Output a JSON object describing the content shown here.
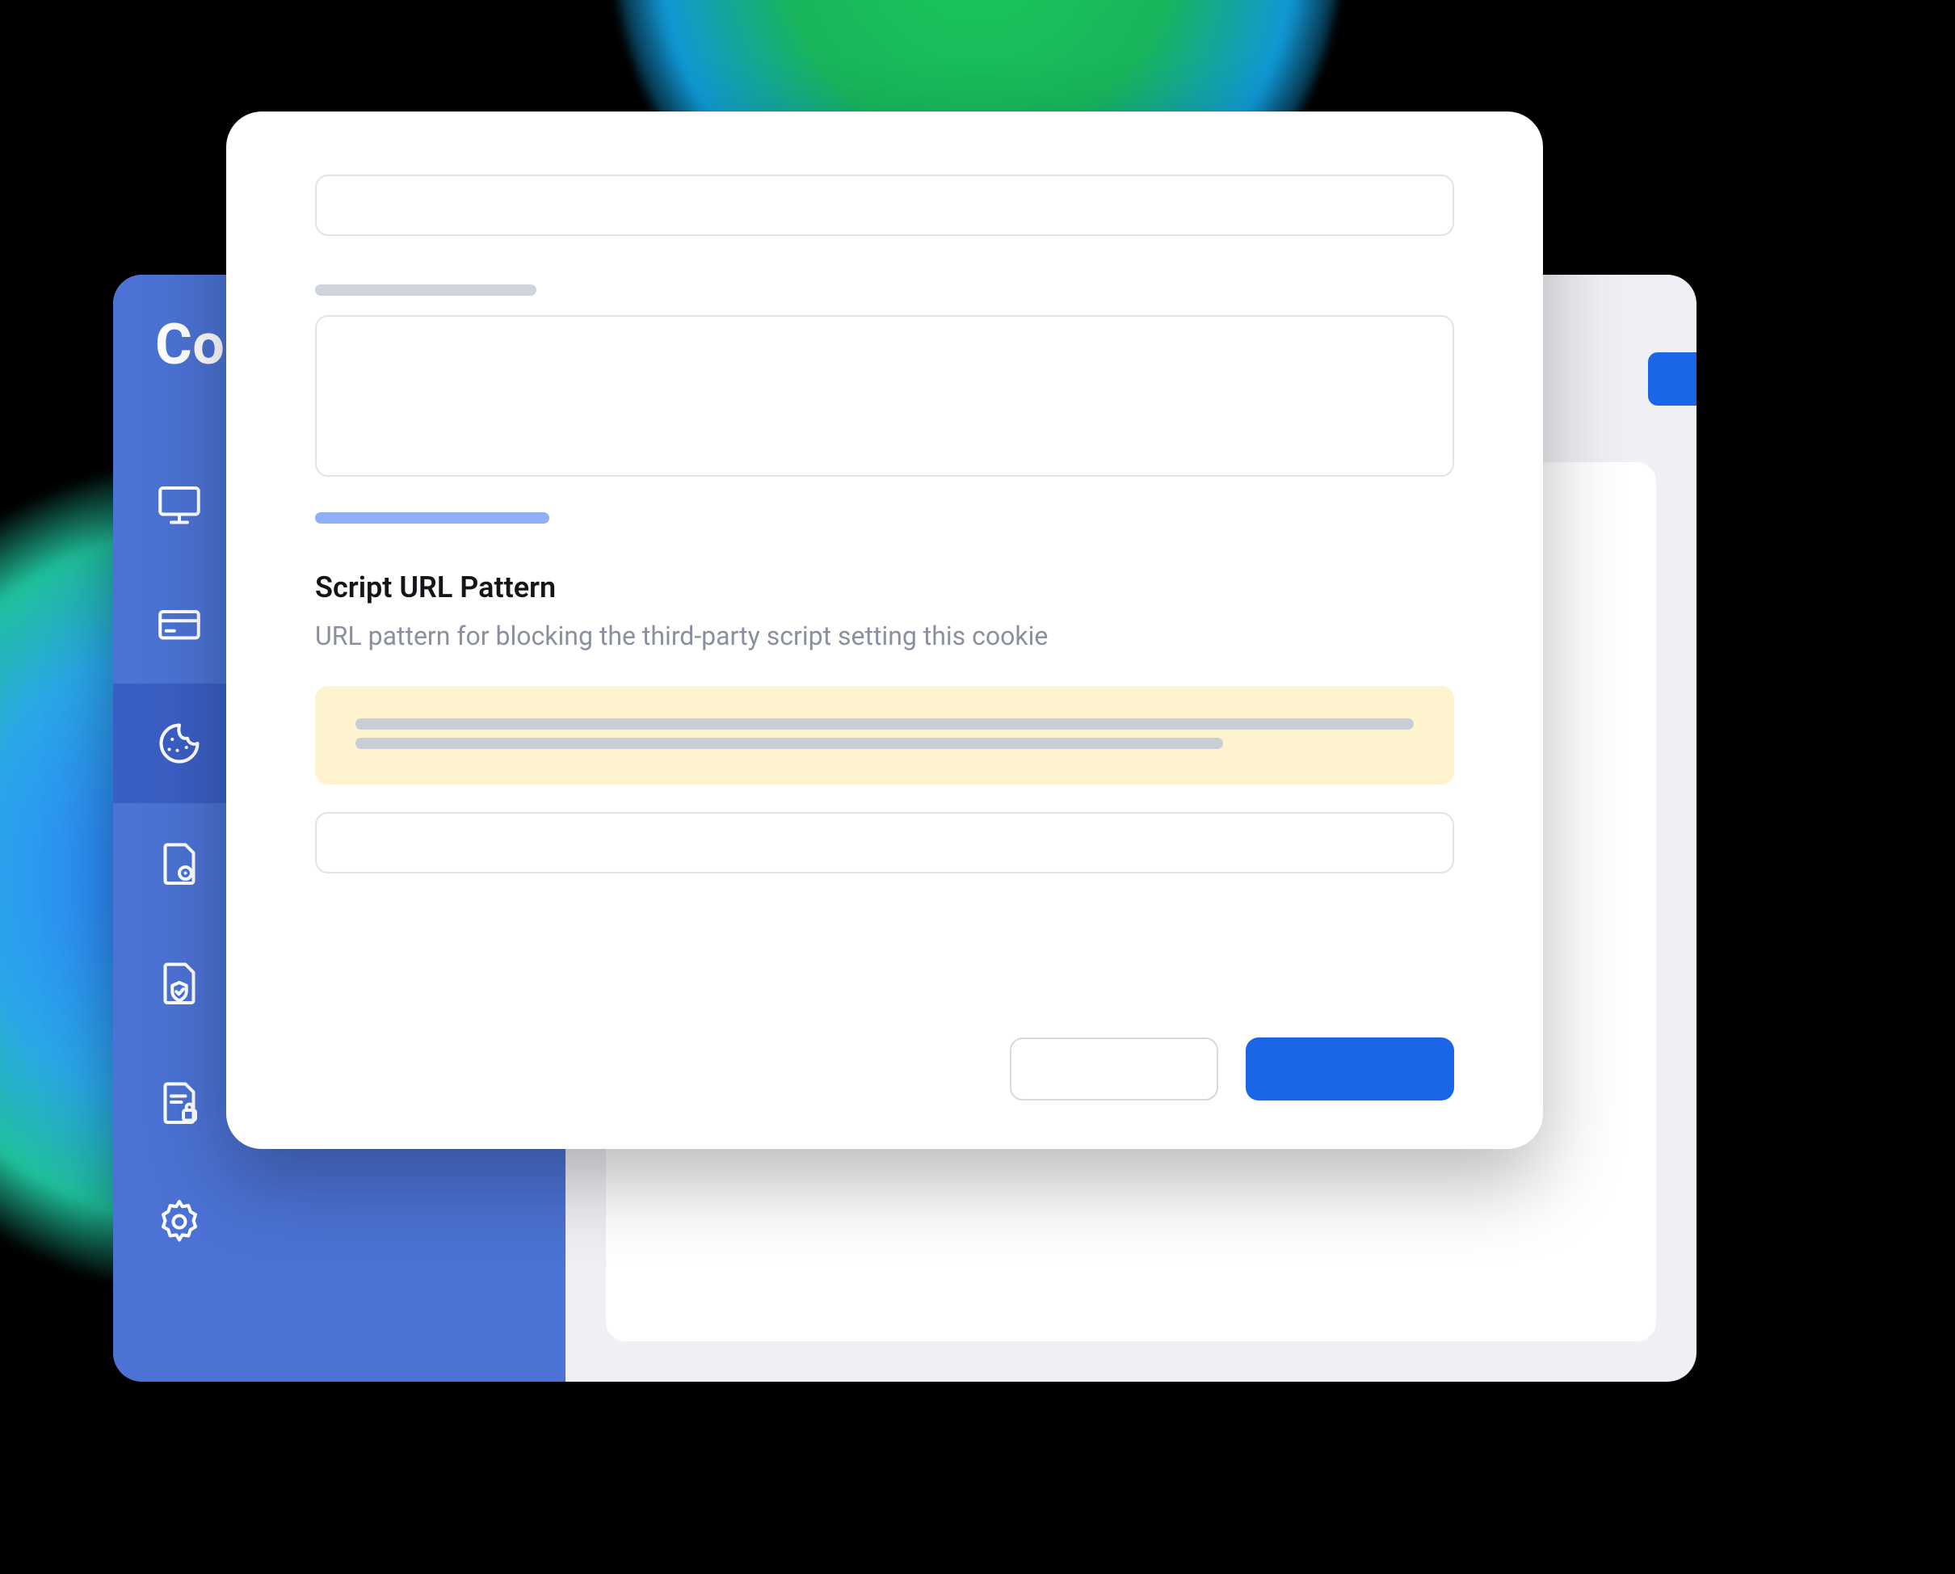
{
  "sidebar": {
    "title_partial": "Coo",
    "items": [
      {
        "icon": "monitor-icon"
      },
      {
        "icon": "credit-card-icon"
      },
      {
        "icon": "cookie-icon",
        "active": true
      },
      {
        "icon": "document-eye-icon"
      },
      {
        "icon": "document-shield-icon"
      },
      {
        "icon": "document-lock-icon"
      },
      {
        "icon": "gear-icon"
      }
    ]
  },
  "modal": {
    "section_title": "Script URL Pattern",
    "section_help": "URL pattern for blocking the third-party script setting this cookie",
    "buttons": {
      "secondary": "",
      "primary": ""
    }
  }
}
